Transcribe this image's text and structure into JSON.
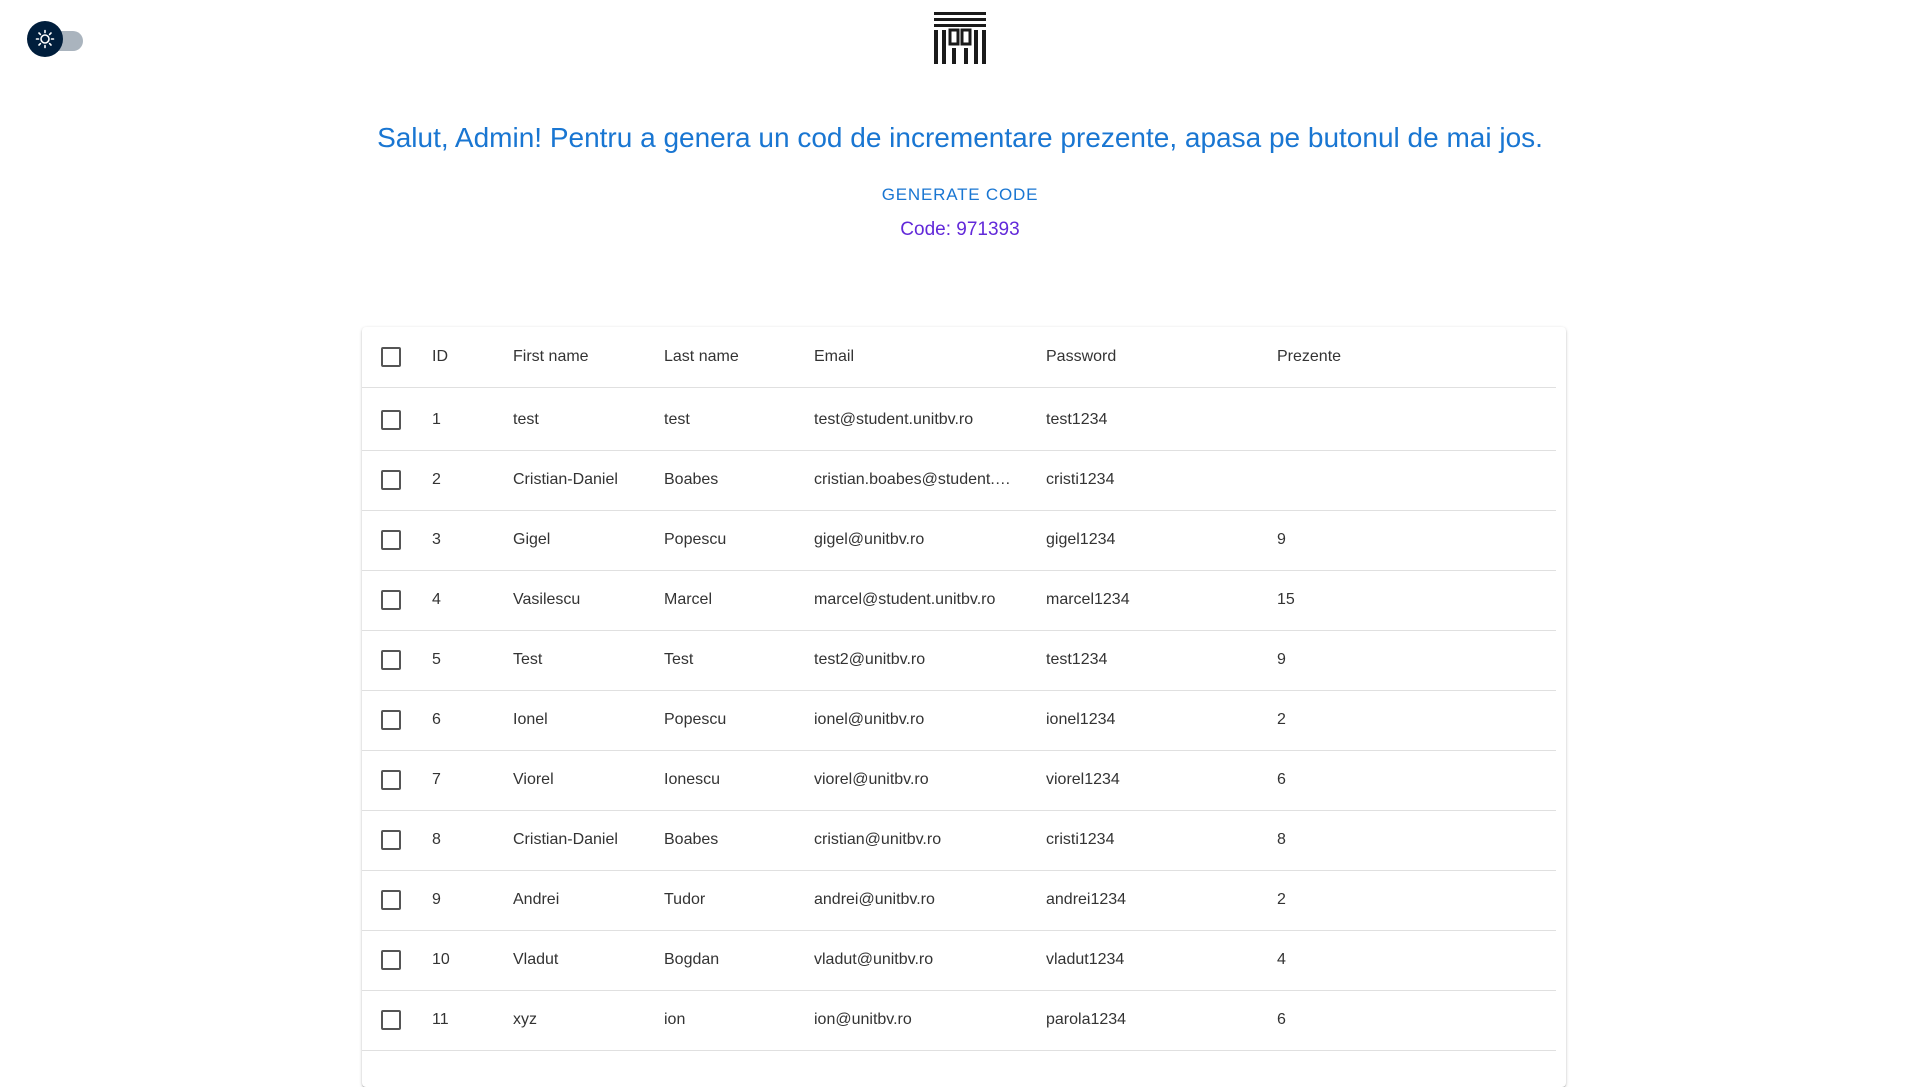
{
  "header": {
    "theme_toggle_icon": "sun-icon",
    "logo_icon": "building-logo-icon"
  },
  "main": {
    "greeting": "Salut, Admin! Pentru a genera un cod de incrementare prezente, apasa pe butonul de mai jos.",
    "generate_button_label": "GENERATE CODE",
    "code_text": "Code: 971393"
  },
  "colors": {
    "primary": "#1976d2",
    "code": "#6229d9",
    "toggle_thumb": "#001e3c",
    "toggle_track": "#aab4be"
  },
  "table": {
    "columns": [
      "ID",
      "First name",
      "Last name",
      "Email",
      "Password",
      "Prezente"
    ],
    "rows": [
      {
        "id": "1",
        "first": "test",
        "last": "test",
        "email": "test@student.unitbv.ro",
        "password": "test1234",
        "prezente": ""
      },
      {
        "id": "2",
        "first": "Cristian-Daniel",
        "last": "Boabes",
        "email": "cristian.boabes@student.unitbv.ro",
        "password": "cristi1234",
        "prezente": ""
      },
      {
        "id": "3",
        "first": "Gigel",
        "last": "Popescu",
        "email": "gigel@unitbv.ro",
        "password": "gigel1234",
        "prezente": "9"
      },
      {
        "id": "4",
        "first": "Vasilescu",
        "last": "Marcel",
        "email": "marcel@student.unitbv.ro",
        "password": "marcel1234",
        "prezente": "15"
      },
      {
        "id": "5",
        "first": "Test",
        "last": "Test",
        "email": "test2@unitbv.ro",
        "password": "test1234",
        "prezente": "9"
      },
      {
        "id": "6",
        "first": "Ionel",
        "last": "Popescu",
        "email": "ionel@unitbv.ro",
        "password": "ionel1234",
        "prezente": "2"
      },
      {
        "id": "7",
        "first": "Viorel",
        "last": "Ionescu",
        "email": "viorel@unitbv.ro",
        "password": "viorel1234",
        "prezente": "6"
      },
      {
        "id": "8",
        "first": "Cristian-Daniel",
        "last": "Boabes",
        "email": "cristian@unitbv.ro",
        "password": "cristi1234",
        "prezente": "8"
      },
      {
        "id": "9",
        "first": "Andrei",
        "last": "Tudor",
        "email": "andrei@unitbv.ro",
        "password": "andrei1234",
        "prezente": "2"
      },
      {
        "id": "10",
        "first": "Vladut",
        "last": "Bogdan",
        "email": "vladut@unitbv.ro",
        "password": "vladut1234",
        "prezente": "4"
      },
      {
        "id": "11",
        "first": "xyz",
        "last": "ion",
        "email": "ion@unitbv.ro",
        "password": "parola1234",
        "prezente": "6"
      }
    ]
  }
}
